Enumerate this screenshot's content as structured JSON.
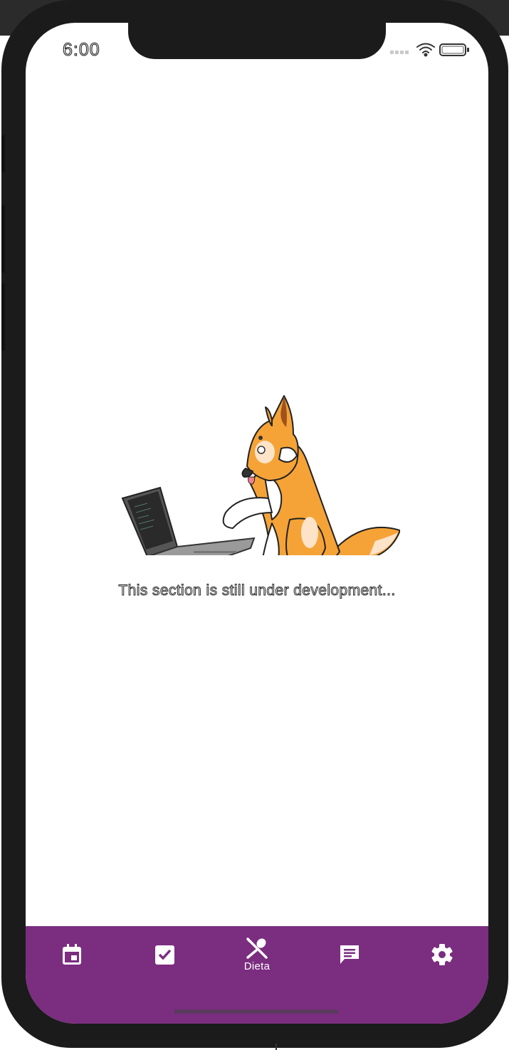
{
  "status_bar": {
    "time": "6:00"
  },
  "main": {
    "message": "This section is still under development..."
  },
  "nav": {
    "items": [
      {
        "name": "calendar",
        "label": "",
        "icon": "calendar-icon"
      },
      {
        "name": "tasks",
        "label": "",
        "icon": "checkbox-icon"
      },
      {
        "name": "diet",
        "label": "Dieta",
        "icon": "fork-spoon-icon",
        "active": true
      },
      {
        "name": "chat",
        "label": "",
        "icon": "chat-icon"
      },
      {
        "name": "settings",
        "label": "",
        "icon": "gear-icon"
      }
    ]
  },
  "colors": {
    "accent": "#7b2d80",
    "fox": "#f5a337",
    "phone_frame": "#1b1b1b"
  }
}
